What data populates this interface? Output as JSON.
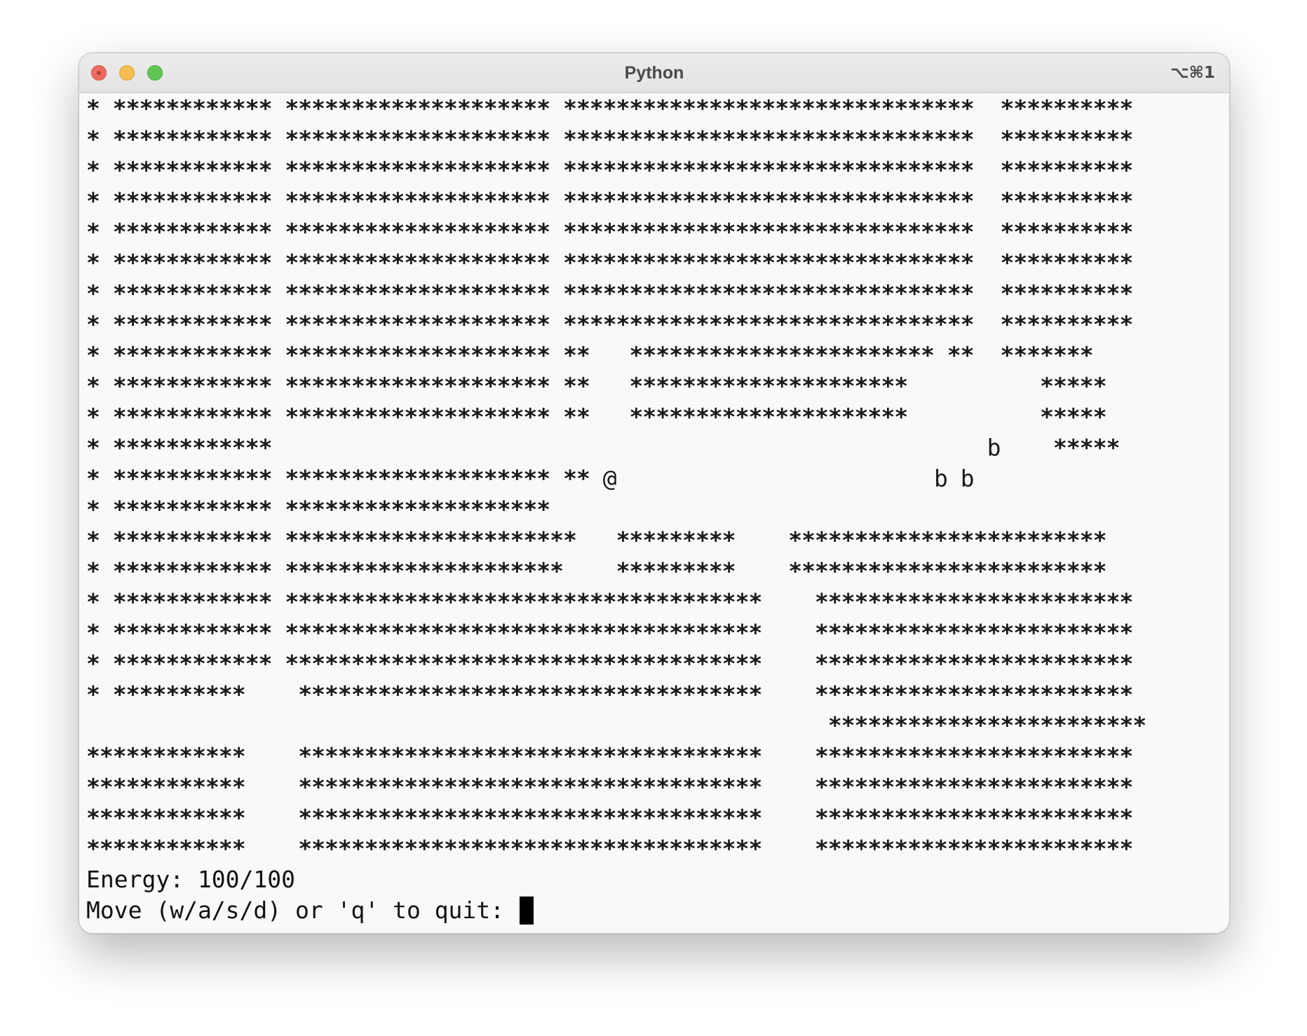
{
  "window": {
    "title": "Python",
    "shortcut": "⌥⌘1"
  },
  "terminal": {
    "map_rows": [
      "* ************ ******************** *******************************  **********",
      "* ************ ******************** *******************************  **********",
      "* ************ ******************** *******************************  **********",
      "* ************ ******************** *******************************  **********",
      "* ************ ******************** *******************************  **********",
      "* ************ ******************** *******************************  **********",
      "* ************ ******************** *******************************  **********",
      "* ************ ******************** *******************************  **********",
      "* ************ ******************** **   *********************** **  *******",
      "* ************ ******************** **   *********************          *****",
      "* ************ ******************** **   *********************          *****",
      "* ************                                                      b    *****",
      "* ************ ******************** ** @                        b b",
      "* ************ ********************",
      "* ************ **********************   *********    ************************",
      "* ************ *********************    *********    ************************",
      "* ************ ************************************    ************************",
      "* ************ ************************************    ************************",
      "* ************ ************************************    ************************",
      "* **********    ***********************************    ************************",
      "                                                        ************************",
      "************    ***********************************    ************************",
      "************    ***********************************    ************************",
      "************    ***********************************    ************************",
      "************    ***********************************    ************************"
    ],
    "energy": "Energy: 100/100",
    "prompt": "Move (w/a/s/d) or 'q' to quit: "
  }
}
